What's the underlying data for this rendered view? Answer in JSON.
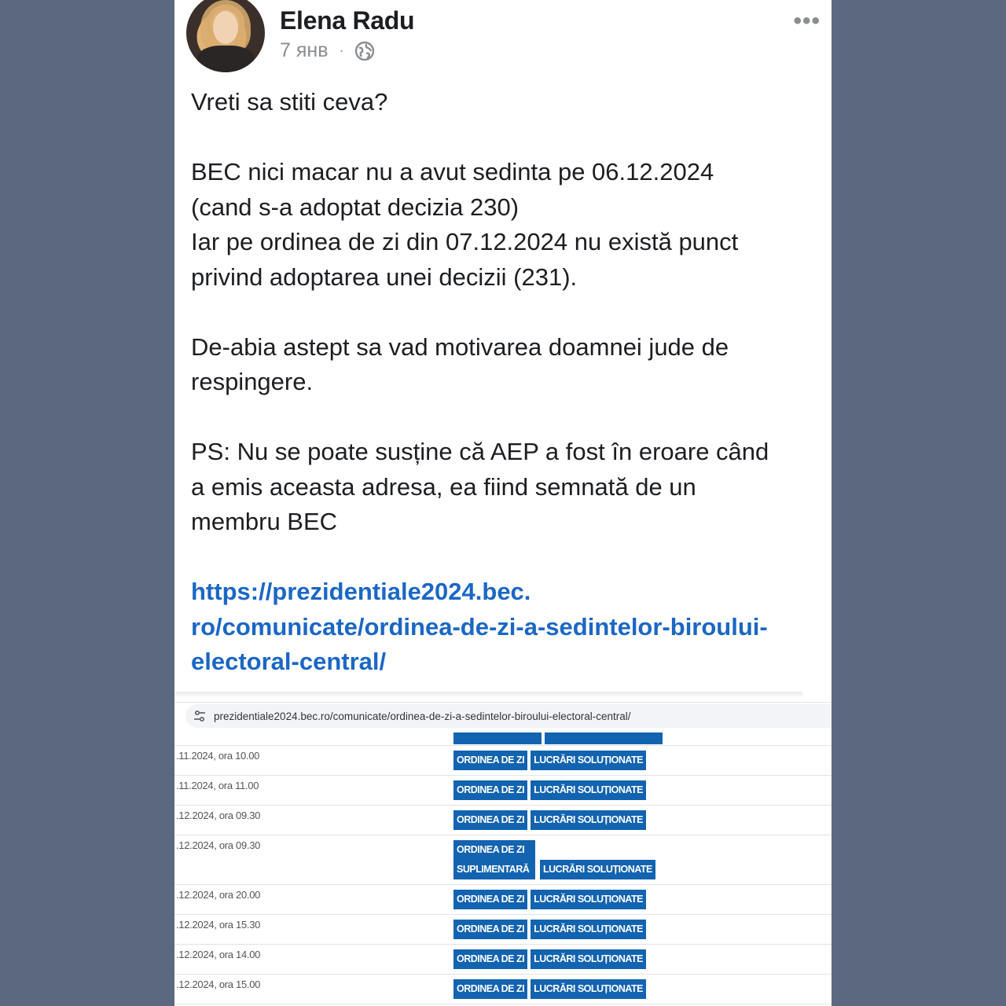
{
  "post": {
    "author": "Elena Radu",
    "date": "7 янв",
    "separator": "·",
    "more_label": "•••",
    "text": {
      "p1": "Vreti sa stiti ceva?",
      "p2_l1": "BEC nici macar nu a avut sedinta pe 06.12.2024",
      "p2_l2": "(cand s-a adoptat decizia 230)",
      "p2_l3": "Iar pe ordinea de zi din 07.12.2024 nu există punct",
      "p2_l4": "privind adoptarea unei decizii (231).",
      "p3_l1": "De-abia astept sa vad motivarea doamnei jude de",
      "p3_l2": "respingere.",
      "p4_l1": "PS: Nu se poate susține că AEP a fost în eroare când",
      "p4_l2": "a emis aceasta adresa, ea fiind semnată de un",
      "p4_l3": "membru BEC",
      "link_l1": "https://prezidentiale2024.bec.",
      "link_l2": "ro/comunicate/ordinea-de-zi-a-sedintelor-biroului-",
      "link_l3": "electoral-central/"
    }
  },
  "screenshot": {
    "url": "prezidentiale2024.bec.ro/comunicate/ordinea-de-zi-a-sedintelor-biroului-electoral-central/",
    "rows": [
      {
        "date": ".11.2024, ora 10.00",
        "btn1": "ORDINEA DE ZI",
        "btn2": "LUCRĂRI SOLUȚIONATE"
      },
      {
        "date": ".11.2024, ora 11.00",
        "btn1": "ORDINEA DE ZI",
        "btn2": "LUCRĂRI SOLUȚIONATE"
      },
      {
        "date": ".12.2024, ora 09.30",
        "btn1": "ORDINEA DE ZI",
        "btn2": "LUCRĂRI SOLUȚIONATE"
      },
      {
        "date": ".12.2024, ora 09.30",
        "btn1": "ORDINEA DE ZI SUPLIMENTARĂ",
        "btn2": "LUCRĂRI SOLUȚIONATE"
      },
      {
        "date": ".12.2024, ora 20.00",
        "btn1": "ORDINEA DE ZI",
        "btn2": "LUCRĂRI SOLUȚIONATE"
      },
      {
        "date": ".12.2024, ora 15.30",
        "btn1": "ORDINEA DE ZI",
        "btn2": "LUCRĂRI SOLUȚIONATE"
      },
      {
        "date": ".12.2024, ora 14.00",
        "btn1": "ORDINEA DE ZI",
        "btn2": "LUCRĂRI SOLUȚIONATE"
      },
      {
        "date": ".12.2024, ora 15.00",
        "btn1": "ORDINEA DE ZI",
        "btn2": "LUCRĂRI SOLUȚIONATE"
      }
    ]
  }
}
